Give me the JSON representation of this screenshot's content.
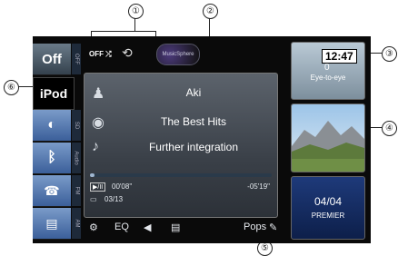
{
  "callouts": [
    "①",
    "②",
    "③",
    "④",
    "⑤",
    "⑥"
  ],
  "sources": {
    "off_label": "Off",
    "ipod_label": "iPod",
    "strip_labels": [
      "OFF",
      "SD",
      "Audio",
      "FM",
      "AM"
    ]
  },
  "topbar": {
    "shuffle_label": "OFF",
    "musicsphere_label": "MusicSphere"
  },
  "now_playing": {
    "artist": "Aki",
    "album": "The Best Hits",
    "song": "Further integration",
    "play_state": "▶/II",
    "elapsed": "00'08\"",
    "remaining": "-05'19\"",
    "track_count": "03/13",
    "progress": 0.025
  },
  "toolbar": {
    "eq_label": "EQ",
    "genre_label": "Pops"
  },
  "artwork": {
    "clock": "12:47",
    "item1_num": "0",
    "item1_title": "Eye-to-eye",
    "item3_num": "04/04",
    "item3_title": "PREMIER"
  },
  "colors": {
    "screen_bg": "#0a0a0a",
    "panel_bg": "#4a5058",
    "source_blue": "#5a7db5",
    "off_button": "#56687a"
  }
}
